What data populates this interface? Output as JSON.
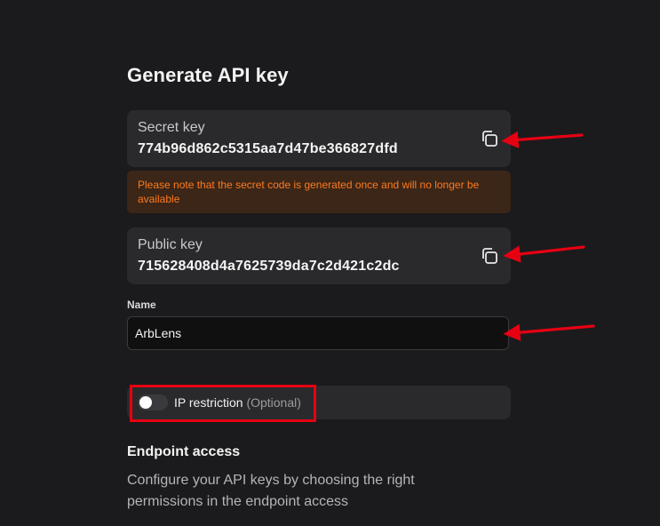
{
  "page": {
    "title": "Generate API key"
  },
  "secret_key": {
    "label": "Secret key",
    "value": "774b96d862c5315aa7d47be366827dfd",
    "copy_icon": "copy-icon"
  },
  "warning": {
    "text": "Please note that the secret code is generated once and will no longer be available"
  },
  "public_key": {
    "label": "Public key",
    "value": "715628408d4a7625739da7c2d421c2dc",
    "copy_icon": "copy-icon"
  },
  "name_field": {
    "label": "Name",
    "value": "ArbLens"
  },
  "ip_restriction": {
    "label": "IP restriction",
    "optional": "(Optional)",
    "enabled": false
  },
  "endpoint_access": {
    "title": "Endpoint access",
    "description": "Configure your API keys by choosing the right permissions in the endpoint access"
  },
  "colors": {
    "background": "#1b1b1d",
    "card": "#2a2a2d",
    "warning_bg": "#3b2617",
    "warning_text": "#ff7a1f",
    "annotation": "#e60012"
  }
}
